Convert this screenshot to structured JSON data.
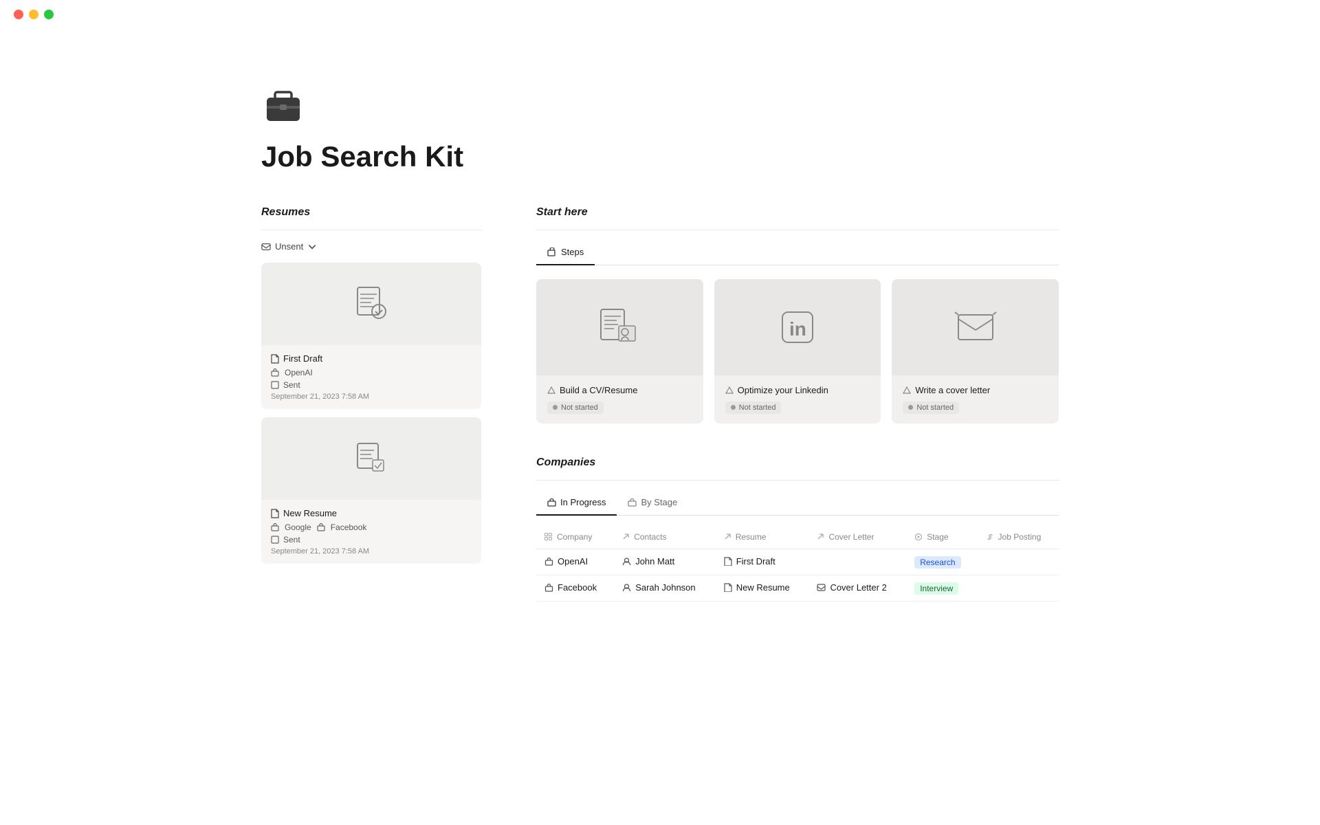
{
  "titlebar": {
    "traffic_lights": [
      "red",
      "yellow",
      "green"
    ]
  },
  "page": {
    "icon_label": "briefcase-icon",
    "title": "Job Search Kit"
  },
  "resumes": {
    "section_label": "Resumes",
    "filter_label": "Unsent",
    "cards": [
      {
        "title": "First Draft",
        "company": "OpenAI",
        "sent_label": "Sent",
        "date": "September 21, 2023 7:58 AM"
      },
      {
        "title": "New Resume",
        "company1": "Google",
        "company2": "Facebook",
        "sent_label": "Sent",
        "date": "September 21, 2023 7:58 AM"
      }
    ]
  },
  "start_here": {
    "section_label": "Start here",
    "tabs": [
      {
        "label": "Steps",
        "active": true
      }
    ],
    "steps": [
      {
        "title": "Build a CV/Resume",
        "status": "Not started"
      },
      {
        "title": "Optimize your Linkedin",
        "status": "Not started"
      },
      {
        "title": "Write a cover letter",
        "status": "Not started"
      }
    ]
  },
  "companies": {
    "section_label": "Companies",
    "tabs": [
      {
        "label": "In Progress",
        "active": true
      },
      {
        "label": "By Stage",
        "active": false
      }
    ],
    "columns": [
      "Company",
      "Contacts",
      "Resume",
      "Cover Letter",
      "Stage",
      "Job Posting"
    ],
    "column_icons": [
      "grid-icon",
      "arrow-icon",
      "arrow-icon",
      "arrow-icon",
      "circle-icon",
      "link-icon"
    ],
    "rows": [
      {
        "company": "OpenAI",
        "contact": "John Matt",
        "resume": "First Draft",
        "cover_letter": "",
        "stage": "Research",
        "stage_type": "research",
        "job_posting": ""
      },
      {
        "company": "Facebook",
        "contact": "Sarah Johnson",
        "resume": "New Resume",
        "cover_letter": "Cover Letter 2",
        "stage": "Interview",
        "stage_type": "interview",
        "job_posting": ""
      }
    ]
  }
}
